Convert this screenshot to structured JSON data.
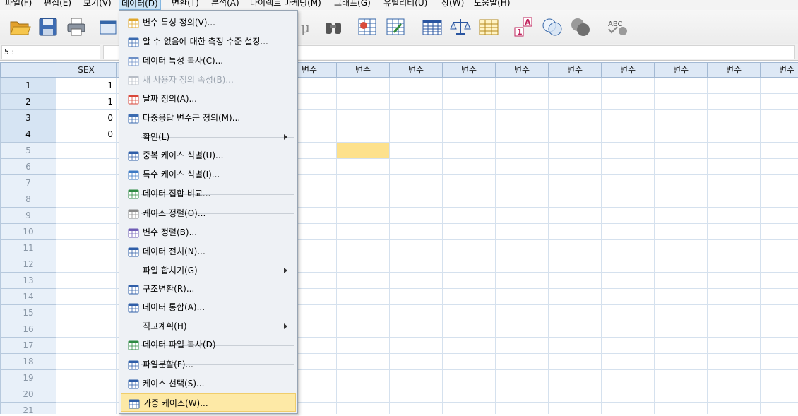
{
  "menubar": {
    "items": [
      {
        "label": "파일(F)"
      },
      {
        "label": "편집(E)"
      },
      {
        "label": "보기(V)"
      },
      {
        "label": "데이터(D)"
      },
      {
        "label": "변환(T)"
      },
      {
        "label": "분석(A)"
      },
      {
        "label": "다이렉트 마케팅(M)"
      },
      {
        "label": "그래프(G)"
      },
      {
        "label": "유틸리티(U)"
      },
      {
        "label": "창(W)"
      },
      {
        "label": "도움말(H)"
      }
    ],
    "active_menu": "데이터(D)"
  },
  "toolbar": {
    "buttons": [
      "open-file-icon",
      "save-icon",
      "print-icon",
      "dialog-recall-icon",
      "variable-stats-icon",
      "find-icon",
      "insert-cases-icon",
      "insert-variable-icon",
      "split-file-icon",
      "weight-cases-icon",
      "select-cases-icon",
      "value-labels-icon",
      "use-sets-icon",
      "show-all-variables-icon",
      "spell-check-icon"
    ]
  },
  "editbar": {
    "cell_ref": "5 :",
    "cell_value": ""
  },
  "grid": {
    "columns": [
      "SEX",
      "",
      "변수",
      "변수",
      "변수",
      "변수",
      "변수",
      "변수",
      "변수",
      "변수",
      "변수",
      "변수"
    ],
    "rows": [
      {
        "num": "1",
        "values": [
          "1"
        ]
      },
      {
        "num": "2",
        "values": [
          "1"
        ]
      },
      {
        "num": "3",
        "values": [
          "0"
        ]
      },
      {
        "num": "4",
        "values": [
          "0"
        ]
      },
      {
        "num": "5",
        "values": []
      },
      {
        "num": "6",
        "values": []
      },
      {
        "num": "7",
        "values": []
      },
      {
        "num": "8",
        "values": []
      },
      {
        "num": "9",
        "values": []
      },
      {
        "num": "10",
        "values": []
      },
      {
        "num": "11",
        "values": []
      },
      {
        "num": "12",
        "values": []
      },
      {
        "num": "13",
        "values": []
      },
      {
        "num": "14",
        "values": []
      },
      {
        "num": "15",
        "values": []
      },
      {
        "num": "16",
        "values": []
      },
      {
        "num": "17",
        "values": []
      },
      {
        "num": "18",
        "values": []
      },
      {
        "num": "19",
        "values": []
      },
      {
        "num": "20",
        "values": []
      },
      {
        "num": "21",
        "values": []
      }
    ],
    "selection_color": "#fde18c"
  },
  "data_menu": {
    "items": [
      {
        "label": "변수 특성 정의(V)...",
        "icon": "define-variable-properties-icon"
      },
      {
        "label": "알 수 없음에 대한 측정 수준 설정...",
        "icon": "measurement-level-icon"
      },
      {
        "label": "데이터 특성 복사(C)...",
        "icon": "copy-data-properties-icon"
      },
      {
        "label": "새 사용자 정의 속성(B)...",
        "icon": "custom-attribute-icon",
        "disabled": true
      },
      {
        "label": "날짜 정의(A)...",
        "icon": "define-dates-icon"
      },
      {
        "label": "다중응답 변수군 정의(M)...",
        "icon": "multiple-response-icon"
      },
      {
        "label": "확인(L)",
        "submenu": true
      },
      {
        "label": "중복 케이스 식별(U)...",
        "icon": "duplicate-cases-icon"
      },
      {
        "label": "특수 케이스 식별(I)...",
        "icon": "unusual-cases-icon"
      },
      {
        "label": "데이터 집합 비교...",
        "icon": "compare-datasets-icon"
      },
      {
        "label": "케이스 정렬(O)...",
        "icon": "sort-cases-icon"
      },
      {
        "label": "변수 정렬(B)...",
        "icon": "sort-variables-icon"
      },
      {
        "label": "데이터 전치(N)...",
        "icon": "transpose-icon"
      },
      {
        "label": "파일 합치기(G)",
        "submenu": true
      },
      {
        "label": "구조변환(R)...",
        "icon": "restructure-icon"
      },
      {
        "label": "데이터 통합(A)...",
        "icon": "aggregate-icon"
      },
      {
        "label": "직교계획(H)",
        "submenu": true
      },
      {
        "label": "데이터 파일 복사(D)",
        "icon": "copy-dataset-icon"
      },
      {
        "label": "파일분할(F)...",
        "icon": "split-file-icon"
      },
      {
        "label": "케이스 선택(S)...",
        "icon": "select-cases-icon"
      },
      {
        "label": "가중 케이스(W)...",
        "icon": "weight-cases-icon",
        "highlighted": true
      }
    ],
    "highlight_color": "#fde9a6"
  }
}
